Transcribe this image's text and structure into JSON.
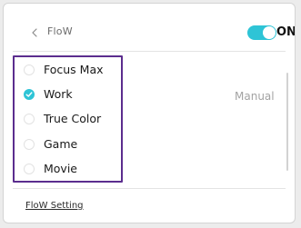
{
  "header": {
    "back_icon": "chevron-left-icon",
    "title": "FloW",
    "toggle": {
      "state": "on",
      "label": "ON",
      "color": "#2ec4d6"
    }
  },
  "modes": {
    "items": [
      {
        "label": "Focus Max",
        "checked": false
      },
      {
        "label": "Work",
        "checked": true
      },
      {
        "label": "True Color",
        "checked": false
      },
      {
        "label": "Game",
        "checked": false
      },
      {
        "label": "Movie",
        "checked": false
      }
    ],
    "highlight_color": "#5b2d8e",
    "check_color": "#2ec4d6"
  },
  "mode_status": "Manual",
  "footer": {
    "setting_link": "FloW Setting"
  }
}
